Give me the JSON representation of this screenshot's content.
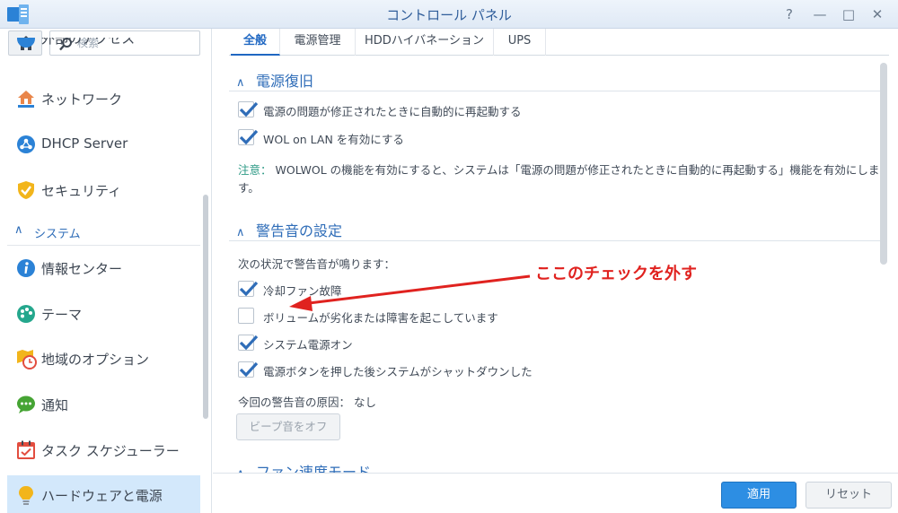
{
  "window": {
    "title": "コントロール パネル",
    "help_glyph": "?",
    "minimize_glyph": "—",
    "maximize_glyph": "□",
    "close_glyph": "✕"
  },
  "sidebar": {
    "search_placeholder": "検索",
    "partial_item_label": "外部のアクセス",
    "items": [
      {
        "label": "ネットワーク",
        "icon": "network-house-icon"
      },
      {
        "label": "DHCP Server",
        "icon": "dhcp-icon"
      },
      {
        "label": "セキュリティ",
        "icon": "shield-icon"
      }
    ],
    "section": {
      "label": "システム",
      "chevron": "∧"
    },
    "system_items": [
      {
        "label": "情報センター",
        "icon": "info-icon"
      },
      {
        "label": "テーマ",
        "icon": "palette-icon"
      },
      {
        "label": "地域のオプション",
        "icon": "regional-clock-icon"
      },
      {
        "label": "通知",
        "icon": "chat-bubble-icon"
      },
      {
        "label": "タスク スケジューラー",
        "icon": "calendar-check-icon"
      },
      {
        "label": "ハードウェアと電源",
        "icon": "lightbulb-icon",
        "active": true
      }
    ]
  },
  "tabs": [
    {
      "label": "全般",
      "active": true
    },
    {
      "label": "電源管理"
    },
    {
      "label": "HDDハイバネーション"
    },
    {
      "label": "UPS"
    }
  ],
  "power_recovery": {
    "title": "電源復旧",
    "chevron": "∧",
    "options": [
      {
        "label": "電源の問題が修正されたときに自動的に再起動する",
        "checked": true
      },
      {
        "label": "WOL on LAN を有効にする",
        "checked": true
      }
    ],
    "note_label": "注意：",
    "note_line1": "WOLWOL の機能を有効にすると、システムは「電源の問題が修正されたときに自動的に再起動する」機能を有効にしま",
    "note_line2": "す。"
  },
  "beep": {
    "title": "警告音の設定",
    "chevron": "∧",
    "intro": "次の状況で警告音が鳴ります：",
    "options": [
      {
        "label": "冷却ファン故障",
        "checked": true
      },
      {
        "label": "ボリュームが劣化または障害を起こしています",
        "checked": false
      },
      {
        "label": "システム電源オン",
        "checked": true
      },
      {
        "label": "電源ボタンを押した後システムがシャットダウンした",
        "checked": true
      }
    ],
    "reason_label": "今回の警告音の原因：",
    "reason_value": "なし",
    "beep_off_button": "ビープ音をオフ"
  },
  "fan": {
    "title": "ファン速度モード",
    "chevron": "∧"
  },
  "annotation": {
    "text": "ここのチェックを外す",
    "color": "#e0221f"
  },
  "footer": {
    "apply": "適用",
    "reset": "リセット"
  },
  "colors": {
    "accent": "#2d8ee3",
    "section_title": "#2f6db8",
    "note": "#2e9a86",
    "active_nav": "#d3e8fb"
  }
}
